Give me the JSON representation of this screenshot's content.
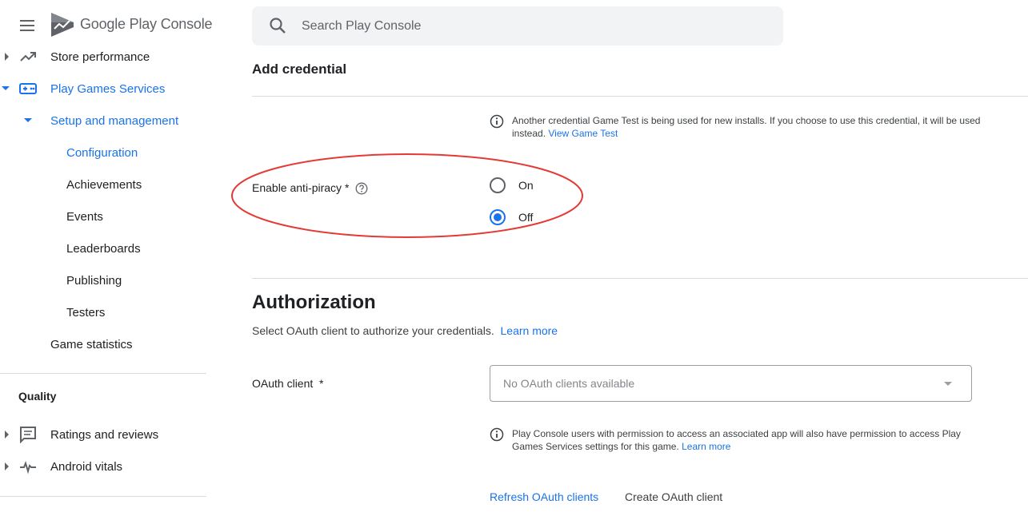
{
  "sidebar": {
    "logo": {
      "google": "Google Play",
      "console": "Console"
    },
    "items": [
      {
        "label": "Store performance"
      },
      {
        "label": "Play Games Services"
      },
      {
        "label": "Setup and management"
      },
      {
        "label": "Configuration"
      },
      {
        "label": "Achievements"
      },
      {
        "label": "Events"
      },
      {
        "label": "Leaderboards"
      },
      {
        "label": "Publishing"
      },
      {
        "label": "Testers"
      },
      {
        "label": "Game statistics"
      }
    ],
    "section_quality": "Quality",
    "quality_items": [
      {
        "label": "Ratings and reviews"
      },
      {
        "label": "Android vitals"
      }
    ]
  },
  "search": {
    "placeholder": "Search Play Console"
  },
  "credential": {
    "title": "Add credential",
    "info_text": "Another credential Game Test is being used for new installs. If you choose to use this credential, it will be used instead.",
    "info_link": "View Game Test",
    "antipiracy_label": "Enable anti-piracy *",
    "options": [
      {
        "label": "On",
        "checked": false
      },
      {
        "label": "Off",
        "checked": true
      }
    ]
  },
  "authorization": {
    "title": "Authorization",
    "subtitle": "Select OAuth client to authorize your credentials.",
    "learn_more": "Learn more",
    "oauth_label": "OAuth client  *",
    "oauth_value": "No OAuth clients available",
    "info_text": "Play Console users with permission to access an associated app will also have permission to access Play Games Services settings for this game.",
    "info_link": "Learn more",
    "refresh_label": "Refresh OAuth clients",
    "create_label": "Create OAuth client"
  },
  "colors": {
    "accent": "#1a73e8",
    "annotation": "#e53935"
  }
}
